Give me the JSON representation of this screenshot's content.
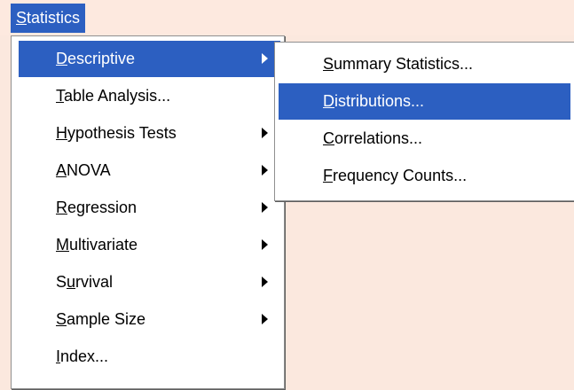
{
  "menubar": {
    "statistics": {
      "accel": "S",
      "rest": "tatistics"
    }
  },
  "main_menu": {
    "descriptive": {
      "pre": "",
      "accel": "D",
      "rest": "escriptive"
    },
    "table_analysis": {
      "pre": "",
      "accel": "T",
      "rest": "able Analysis..."
    },
    "hypothesis_tests": {
      "pre": "",
      "accel": "H",
      "rest": "ypothesis Tests"
    },
    "anova": {
      "pre": "",
      "accel": "A",
      "rest": "NOVA"
    },
    "regression": {
      "pre": "",
      "accel": "R",
      "rest": "egression"
    },
    "multivariate": {
      "pre": "",
      "accel": "M",
      "rest": "ultivariate"
    },
    "survival": {
      "pre": "S",
      "accel": "u",
      "rest": "rvival"
    },
    "sample_size": {
      "pre": "",
      "accel": "S",
      "rest": "ample Size"
    },
    "index": {
      "pre": "",
      "accel": "I",
      "rest": "ndex..."
    }
  },
  "sub_menu": {
    "summary_statistics": {
      "pre": "",
      "accel": "S",
      "rest": "ummary Statistics..."
    },
    "distributions": {
      "pre": "",
      "accel": "D",
      "rest": "istributions..."
    },
    "correlations": {
      "pre": "",
      "accel": "C",
      "rest": "orrelations..."
    },
    "frequency_counts": {
      "pre": "",
      "accel": "F",
      "rest": "requency Counts..."
    }
  },
  "colors": {
    "highlight": "#2c5fc1",
    "background": "#fbe8de"
  }
}
